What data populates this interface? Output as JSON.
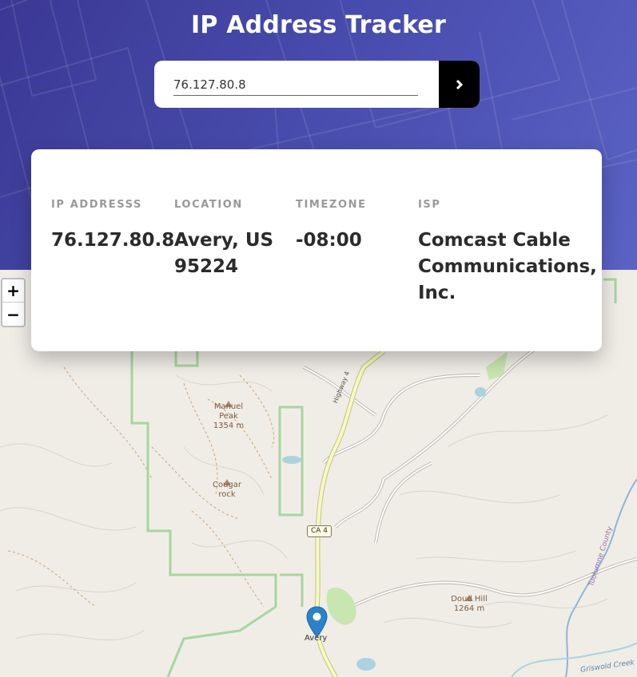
{
  "header": {
    "title": "IP Address Tracker"
  },
  "search": {
    "value": "76.127.80.8",
    "button_icon": "chevron-right-icon"
  },
  "info": {
    "ip_label": "IP ADDRESSS",
    "ip_value": "76.127.80.8",
    "location_label": "LOCATION",
    "location_value": "Avery, US 95224",
    "timezone_label": "TIMEZONE",
    "timezone_value": "-08:00",
    "isp_label": "ISP",
    "isp_value": "Comcast Cable Communications, Inc."
  },
  "map": {
    "zoom_in": "+",
    "zoom_out": "−",
    "labels": {
      "manuel_peak_name": "Manuel Peak",
      "manuel_peak_elev": "1354 m",
      "cougar_rock": "Cougar rock",
      "doud_hill_name": "Doud Hill",
      "doud_hill_elev": "1264 m",
      "avery": "Avery",
      "ca4_shield": "CA 4",
      "highway4": "Highway 4",
      "tuolumne_county": "Tuolumne County",
      "griswold_creek": "Griswold Creek"
    }
  },
  "colors": {
    "hero_start": "#3b3894",
    "hero_end": "#5a63c4",
    "map_bg": "#f0ede6",
    "road_main": "#f7fabf",
    "boundary": "#a8d5a0",
    "water": "#aad3df",
    "marker": "#2b82cb"
  }
}
